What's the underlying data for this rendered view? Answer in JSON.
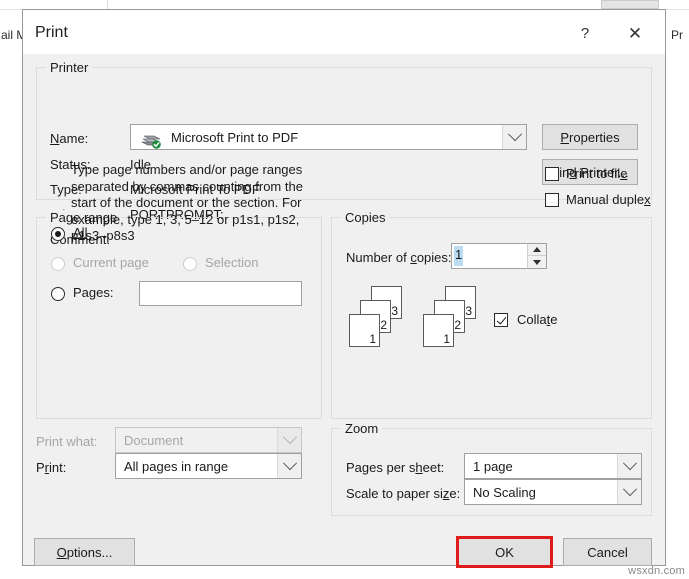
{
  "background": {
    "left_text": "ail M",
    "right_text": "Pr"
  },
  "dialog": {
    "title": "Print",
    "help_icon": "?",
    "close_icon": "✕"
  },
  "printer": {
    "group_title": "Printer",
    "name_label": "Name:",
    "name_accel": "N",
    "name_value": "Microsoft Print to PDF",
    "status_label": "Status:",
    "status_value": "Idle",
    "type_label": "Type:",
    "type_value": "Microsoft Print To PDF",
    "where_label": "Where:",
    "where_value": "PORTPROMPT:",
    "comment_label": "Comment:",
    "comment_value": "",
    "properties_button": "Properties",
    "properties_accel": "P",
    "find_printer_button": "Find Printer...",
    "find_printer_accel": "d",
    "print_to_file_label": "Print to file",
    "print_to_file_accel": "e",
    "print_to_file_checked": false,
    "manual_duplex_label": "Manual duplex",
    "manual_duplex_accel": "x",
    "manual_duplex_checked": false,
    "icon": "printer-icon"
  },
  "page_range": {
    "group_title": "Page range",
    "options": [
      {
        "label": "All",
        "accel": "All",
        "selected": true,
        "disabled": false
      },
      {
        "label": "Current page",
        "accel": "",
        "selected": false,
        "disabled": true
      },
      {
        "label": "Selection",
        "accel": "",
        "selected": false,
        "disabled": true
      },
      {
        "label": "Pages:",
        "accel": "g",
        "selected": false,
        "disabled": false
      }
    ],
    "pages_value": "",
    "help_text": "Type page numbers and/or page ranges separated by commas counting from the start of the document or the section. For example, type 1, 3, 5–12 or p1s1, p1s2, p1s3–p8s3"
  },
  "copies": {
    "group_title": "Copies",
    "number_label": "Number of copies:",
    "number_accel": "c",
    "number_value": "1",
    "collate_label": "Collate",
    "collate_accel": "t",
    "collate_checked": true,
    "stack_page_numbers": [
      "1",
      "2",
      "3"
    ]
  },
  "print_what": {
    "label": "Print what:",
    "accel": "",
    "value": "Document",
    "disabled": true
  },
  "print_range": {
    "label": "Print:",
    "accel": "r",
    "value": "All pages in range",
    "disabled": false
  },
  "zoom": {
    "group_title": "Zoom",
    "pages_per_sheet_label": "Pages per sheet:",
    "pages_per_sheet_accel": "h",
    "pages_per_sheet_value": "1 page",
    "scale_label": "Scale to paper size:",
    "scale_accel": "z",
    "scale_value": "No Scaling"
  },
  "footer": {
    "options_button": "Options...",
    "options_accel": "O",
    "ok_button": "OK",
    "cancel_button": "Cancel",
    "highlight_color": "#e01b1b"
  },
  "watermark": "wsxdn.com"
}
